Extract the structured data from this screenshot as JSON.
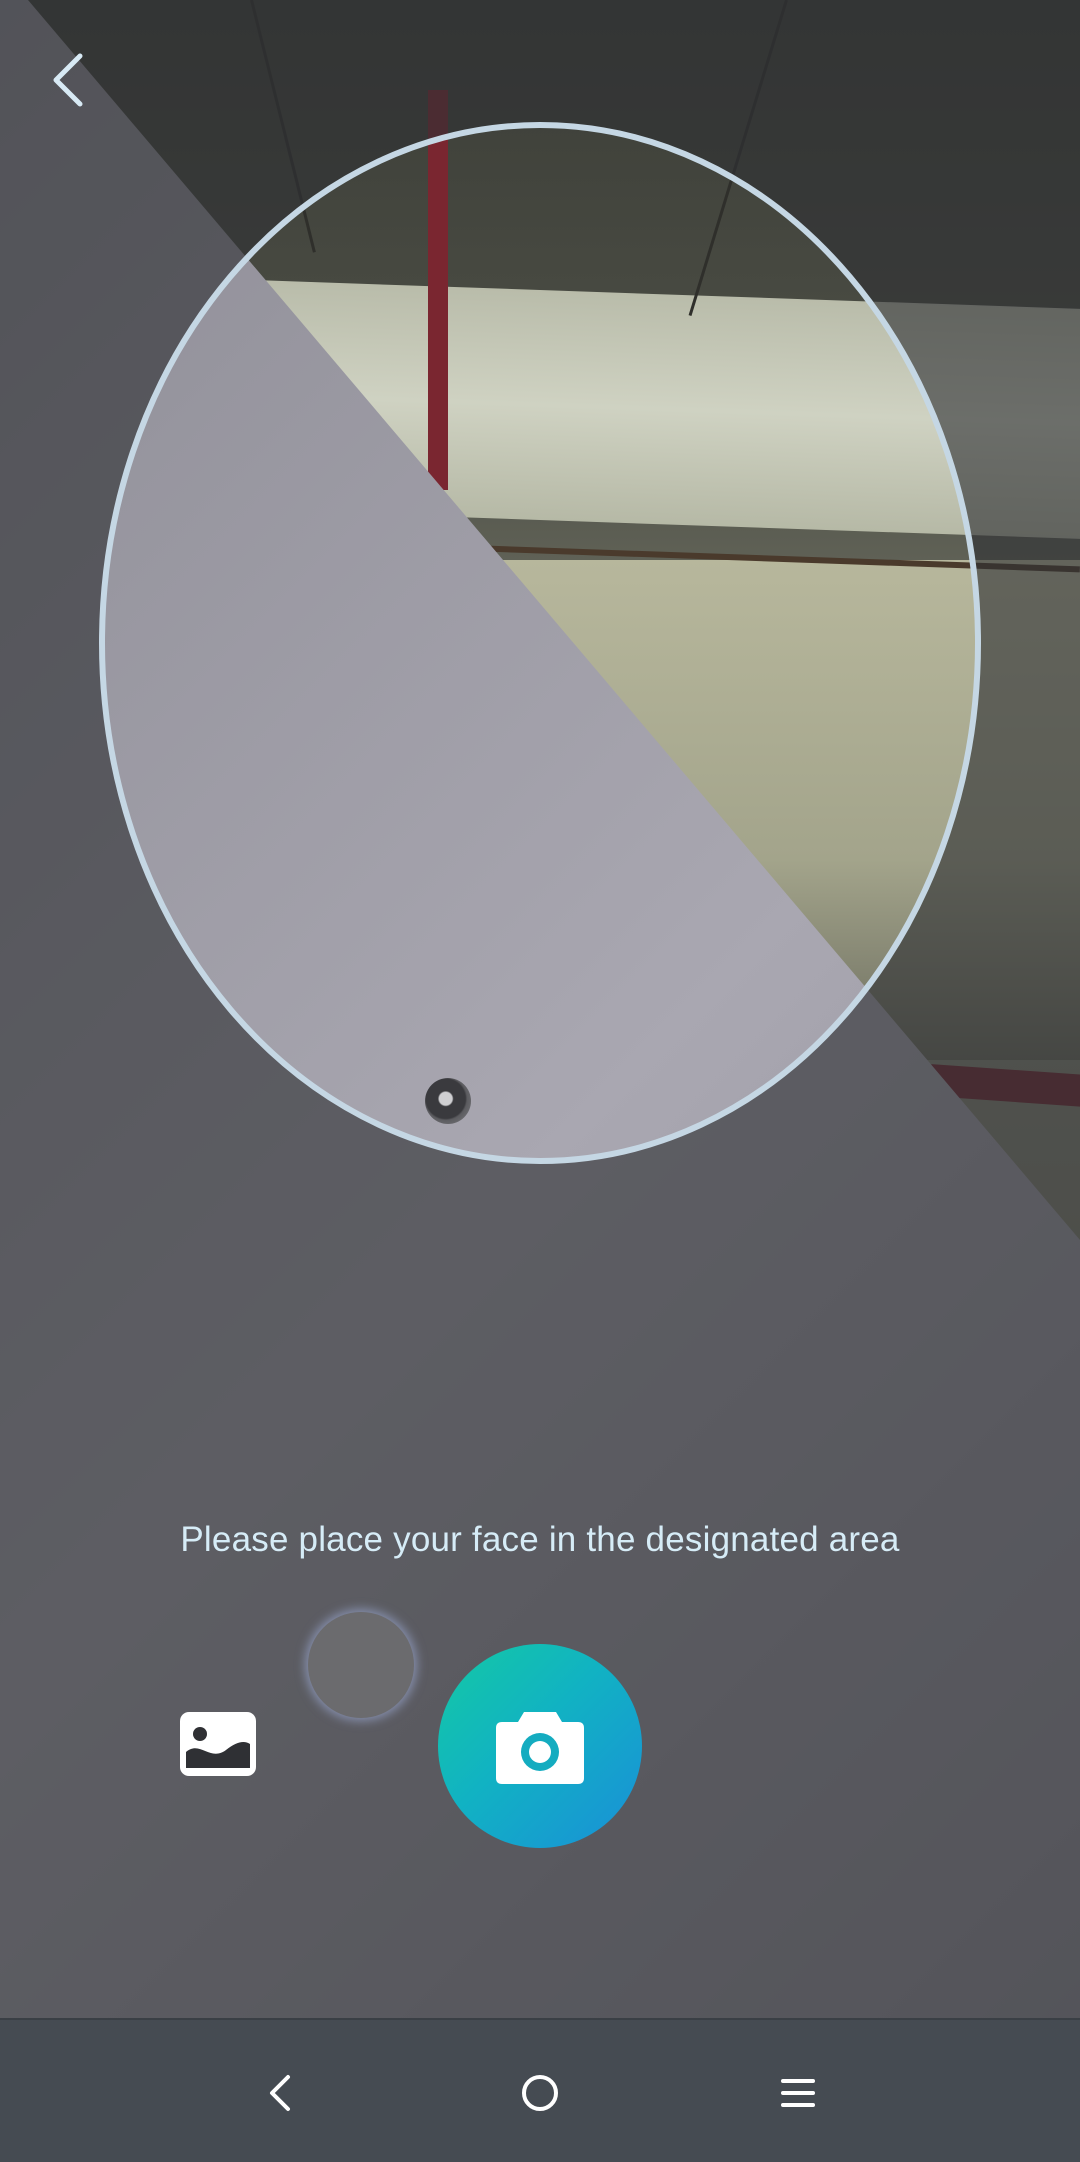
{
  "camera": {
    "prompt_text": "Please place your face in the designated area"
  },
  "controls": {
    "back_icon": "chevron-left-icon",
    "gallery_icon": "image-icon",
    "shutter_icon": "camera-icon"
  },
  "colors": {
    "overlay": "#2f3034",
    "oval_border": "#c5d7e4",
    "prompt_text": "#d6ecf7",
    "shutter_start": "#14c9a4",
    "shutter_end": "#1a8fd8",
    "navbar": "#454b52"
  },
  "navbar": {
    "items": [
      "back-icon",
      "home-icon",
      "menu-icon"
    ]
  }
}
